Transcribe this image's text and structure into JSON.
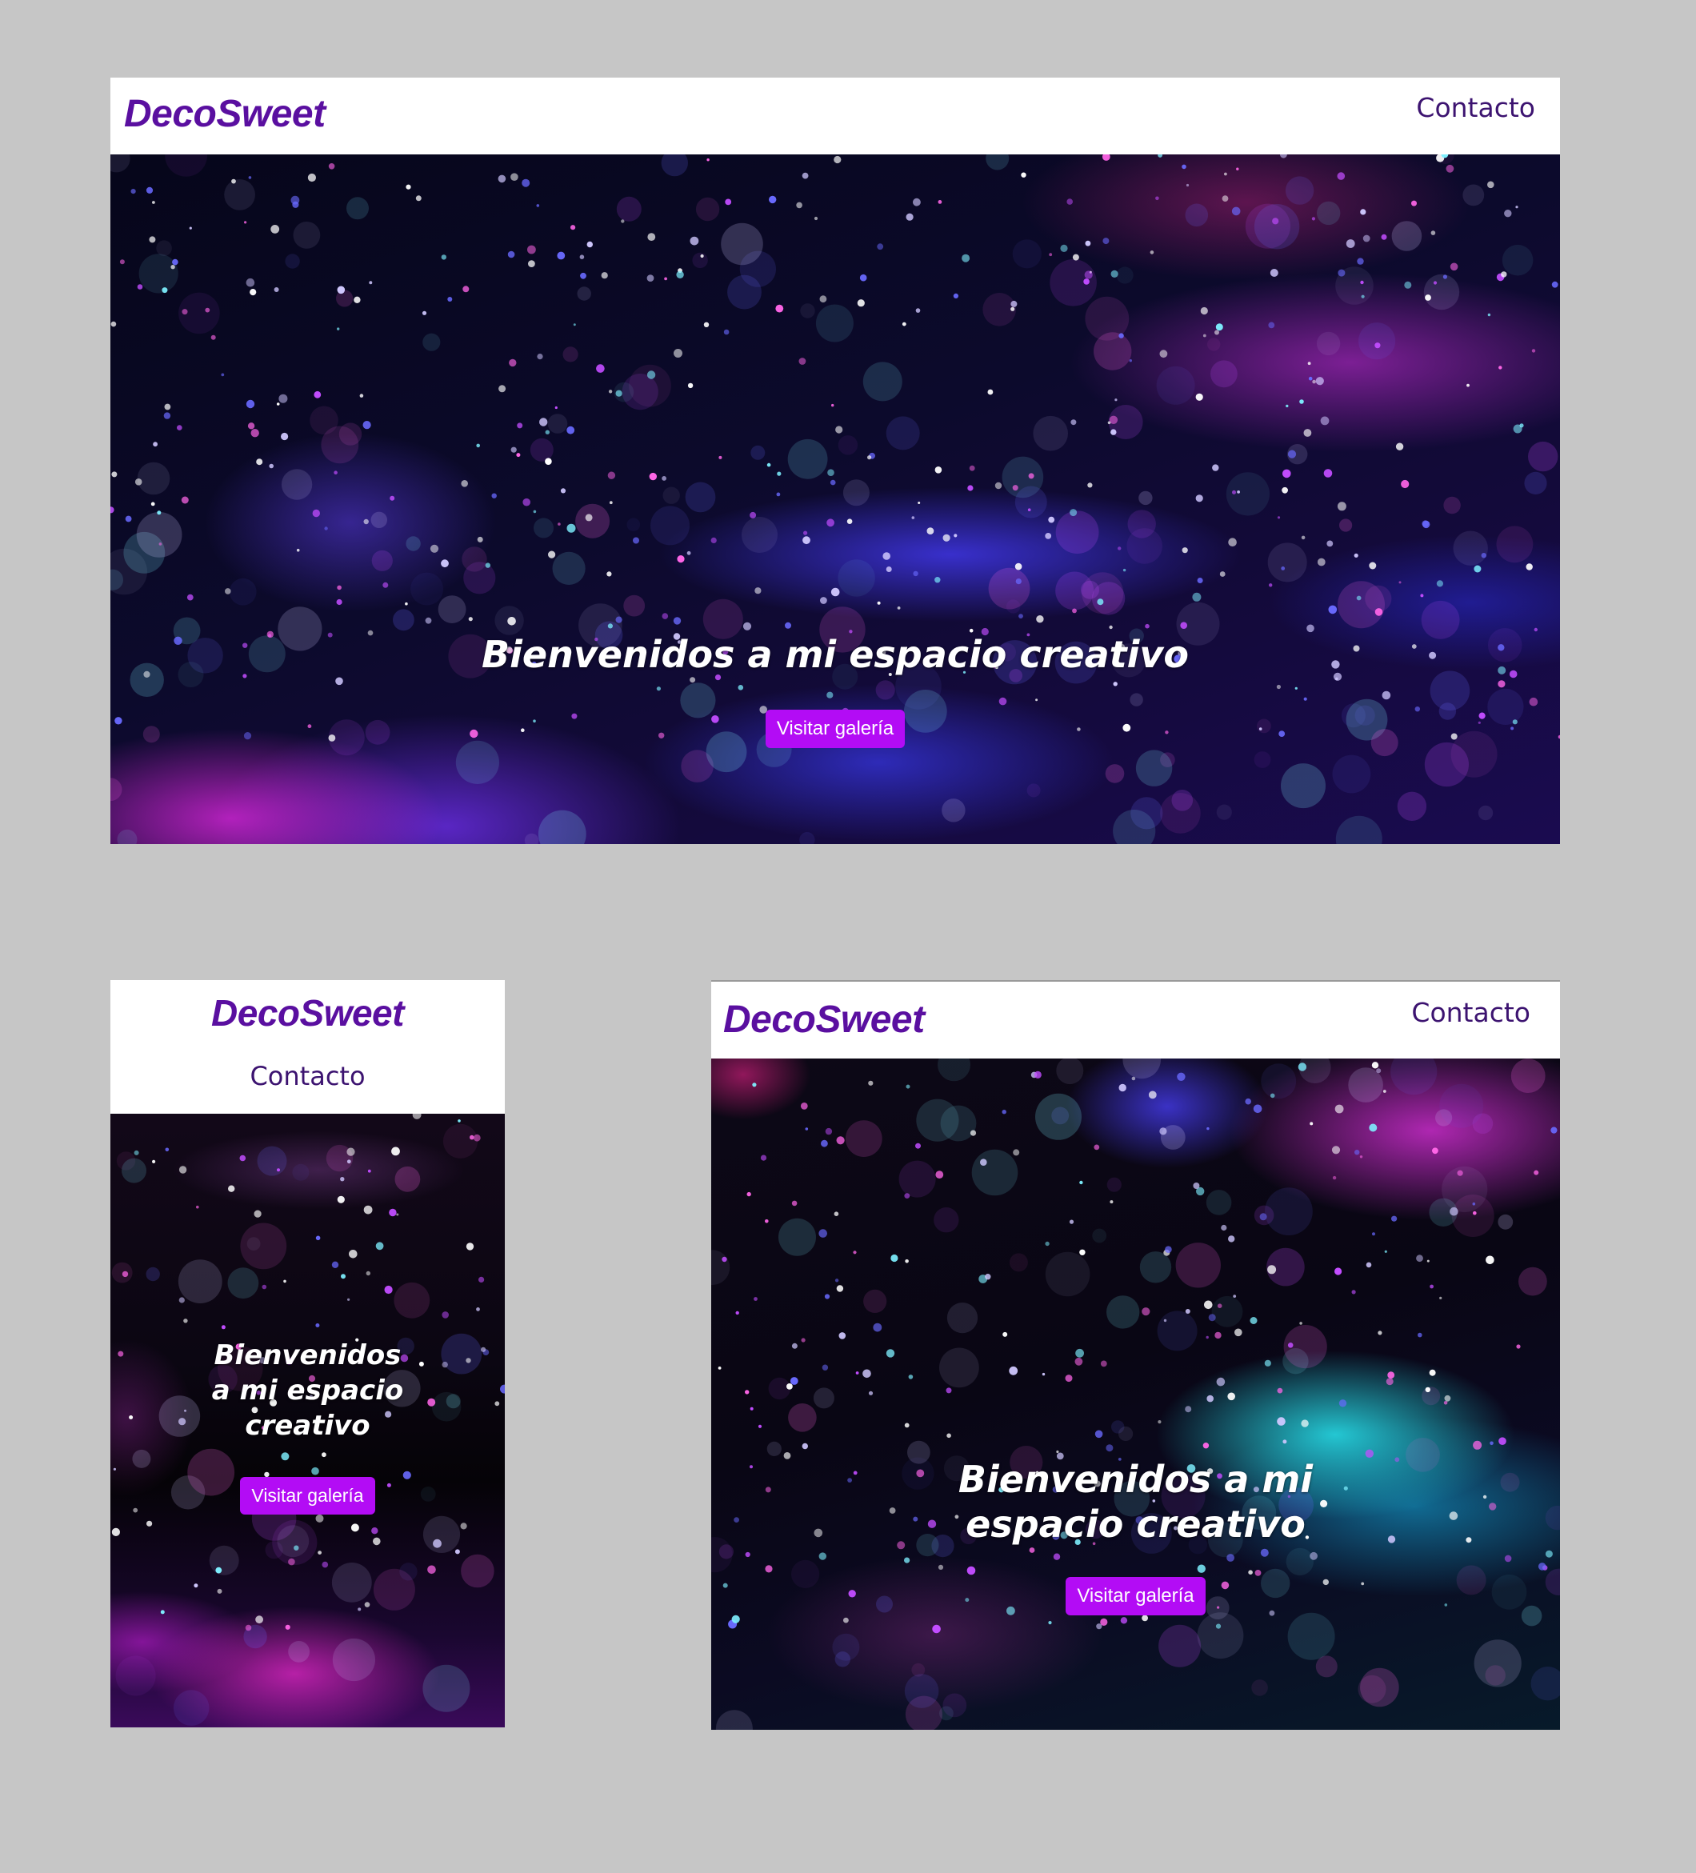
{
  "brand": {
    "name": "DecoSweet",
    "color": "#5a0fa0"
  },
  "nav": {
    "contact_label": "Contacto"
  },
  "hero": {
    "title": "Bienvenidos a mi espacio creativo",
    "mobile_title_lines": [
      "Bienvenidos",
      "a mi espacio",
      "creativo"
    ],
    "tablet_title_lines": [
      "Bienvenidos a mi",
      "espacio creativo"
    ],
    "button_label": "Visitar galería",
    "button_color": "#b30cf5",
    "background_image": "purple-blue bokeh nebula"
  },
  "mockups": [
    {
      "name": "desktop"
    },
    {
      "name": "mobile"
    },
    {
      "name": "tablet"
    }
  ]
}
